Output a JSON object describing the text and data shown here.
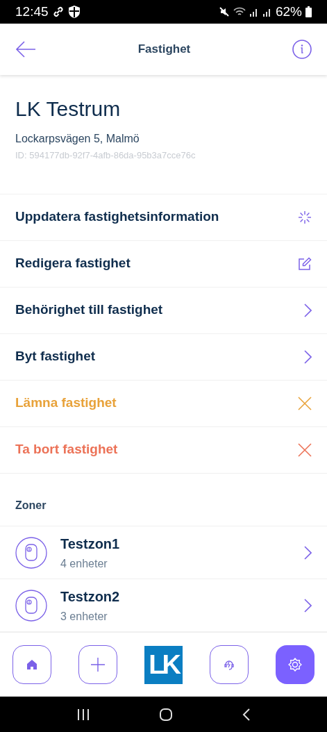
{
  "status_bar": {
    "time": "12:45",
    "battery": "62%"
  },
  "header": {
    "title": "Fastighet"
  },
  "property": {
    "name": "LK Testrum",
    "address": "Lockarpsvägen 5, Malmö",
    "id": "ID: 594177db-92f7-4afb-86da-95b3a7cce76c"
  },
  "actions": [
    {
      "label": "Uppdatera fastighetsinformation",
      "kind": "loading",
      "color": "#0f2d4d"
    },
    {
      "label": "Redigera fastighet",
      "kind": "edit",
      "color": "#0f2d4d"
    },
    {
      "label": "Behörighet till fastighet",
      "kind": "chevron",
      "color": "#0f2d4d"
    },
    {
      "label": "Byt fastighet",
      "kind": "chevron",
      "color": "#0f2d4d"
    },
    {
      "label": "Lämna fastighet",
      "kind": "close",
      "color": "#e8a23a"
    },
    {
      "label": "Ta bort fastighet",
      "kind": "close",
      "color": "#ec7257"
    }
  ],
  "zones": {
    "title": "Zoner",
    "items": [
      {
        "name": "Testzon1",
        "devices": "4 enheter"
      },
      {
        "name": "Testzon2",
        "devices": "3 enheter"
      }
    ]
  },
  "bottom_nav": [
    {
      "kind": "home",
      "selected": false
    },
    {
      "kind": "add",
      "selected": false
    },
    {
      "kind": "logo",
      "text": "LK",
      "selected": false
    },
    {
      "kind": "support",
      "selected": false
    },
    {
      "kind": "settings",
      "selected": true
    }
  ]
}
